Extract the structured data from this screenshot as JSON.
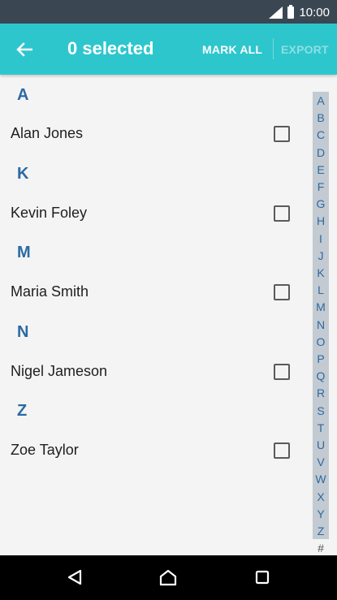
{
  "status_bar": {
    "time": "10:00"
  },
  "toolbar": {
    "title": "0 selected",
    "mark_all_label": "MARK ALL",
    "export_label": "EXPORT"
  },
  "sections": [
    {
      "letter": "A",
      "contacts": [
        {
          "name": "Alan Jones",
          "checked": false
        }
      ]
    },
    {
      "letter": "K",
      "contacts": [
        {
          "name": "Kevin Foley",
          "checked": false
        }
      ]
    },
    {
      "letter": "M",
      "contacts": [
        {
          "name": "Maria Smith",
          "checked": false
        }
      ]
    },
    {
      "letter": "N",
      "contacts": [
        {
          "name": "Nigel Jameson",
          "checked": false
        }
      ]
    },
    {
      "letter": "Z",
      "contacts": [
        {
          "name": "Zoe Taylor",
          "checked": false
        }
      ]
    }
  ],
  "index": [
    "A",
    "B",
    "C",
    "D",
    "E",
    "F",
    "G",
    "H",
    "I",
    "J",
    "K",
    "L",
    "M",
    "N",
    "O",
    "P",
    "Q",
    "R",
    "S",
    "T",
    "U",
    "V",
    "W",
    "X",
    "Y",
    "Z",
    "#"
  ],
  "colors": {
    "accent": "#2ec6cd",
    "section_letter": "#2b6aa3",
    "status_bar": "#3a4752"
  }
}
